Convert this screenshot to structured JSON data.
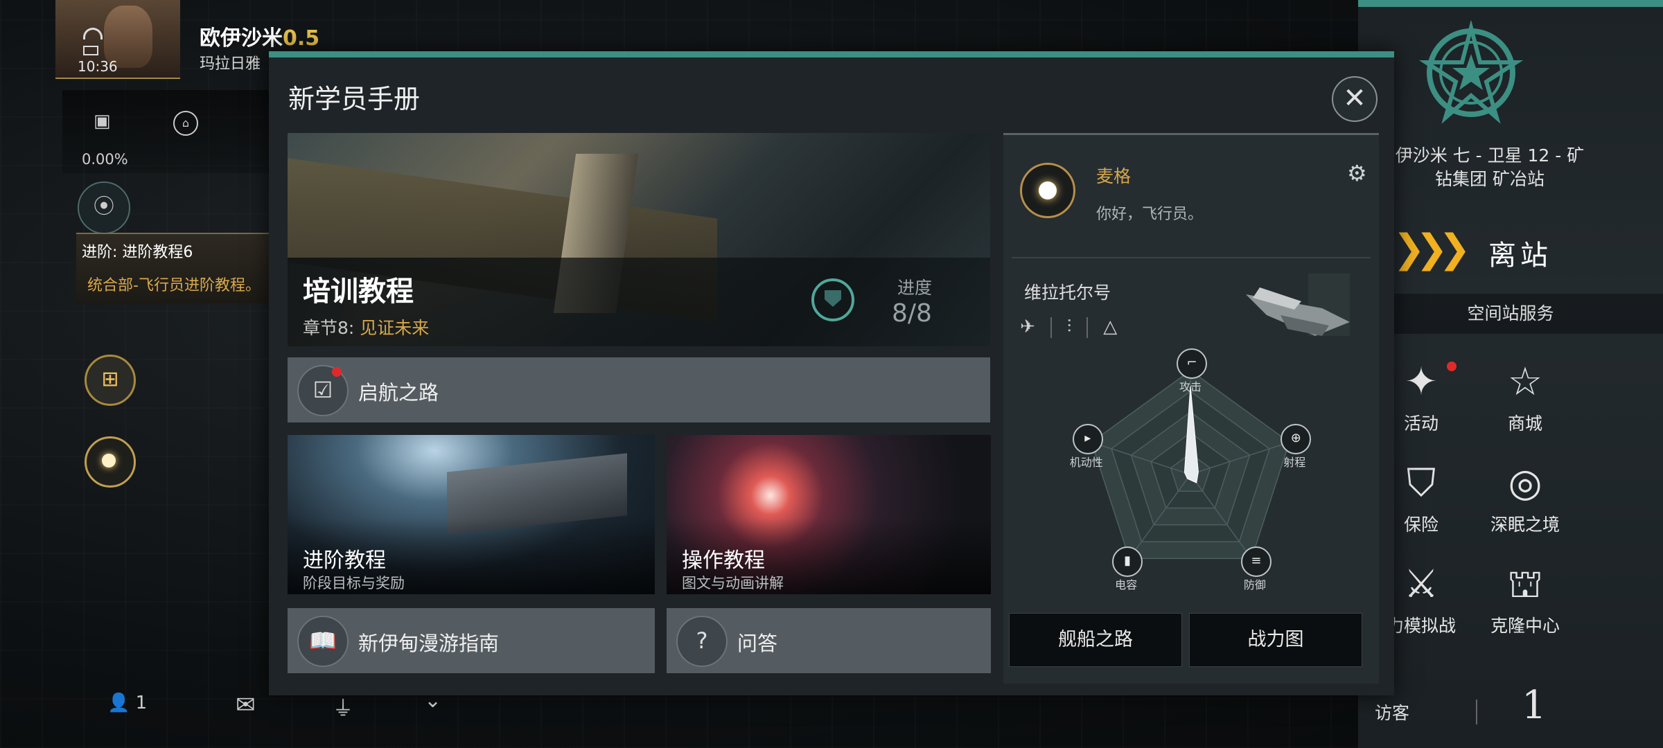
{
  "hud": {
    "time": "10:36",
    "system_name": "欧伊沙米",
    "security": "0.5",
    "region": "玛拉日雅",
    "cargo_percent": "0.00%",
    "mission_title": "进阶: 进阶教程6",
    "mission_desc": "统合部-飞行员进阶教程。",
    "player_count": "1"
  },
  "modal": {
    "title": "新学员手册",
    "hero": {
      "title": "培训教程",
      "chapter_prefix": "章节8:",
      "chapter_name": "见证未来",
      "progress_label": "进度",
      "progress": "8/8"
    },
    "launch_path": "启航之路",
    "cards": [
      {
        "title": "进阶教程",
        "subtitle": "阶段目标与奖励"
      },
      {
        "title": "操作教程",
        "subtitle": "图文与动画讲解"
      }
    ],
    "guide": "新伊甸漫游指南",
    "qa": "问答",
    "side": {
      "pilot_name": "麦格",
      "greeting": "你好，飞行员。",
      "ship_name": "维拉托尔号",
      "radar_axes": [
        "攻击",
        "射程",
        "防御",
        "电容",
        "机动性"
      ],
      "radar_values": [
        0.85,
        0.08,
        0.1,
        0.05,
        0.06
      ],
      "buttons": [
        "舰船之路",
        "战力图"
      ]
    }
  },
  "right": {
    "station_line1": "伊沙米 七 - 卫星 12 - 矿",
    "station_line2": "钻集团 矿冶站",
    "undock": "离站",
    "services_header": "空间站服务",
    "services": [
      "活动",
      "商城",
      "保险",
      "深眠之境",
      "力模拟战",
      "克隆中心"
    ],
    "visitor_label": "访客",
    "visitor_count": "1"
  },
  "colors": {
    "accent_teal": "#3c8f83",
    "gold": "#d6a84a",
    "security_yellow": "#e6c14a",
    "undock_orange": "#f0b020",
    "notify_red": "#e02a2a"
  },
  "icons": [
    "wifi-icon",
    "battery-icon",
    "cargo-icon",
    "station-icon",
    "location-icon",
    "gift-icon",
    "agency-icon",
    "people-icon",
    "mail-icon",
    "filter-icon",
    "chevron-down-icon",
    "close-icon",
    "gear-icon",
    "checklist-icon",
    "book-icon",
    "question-icon"
  ]
}
